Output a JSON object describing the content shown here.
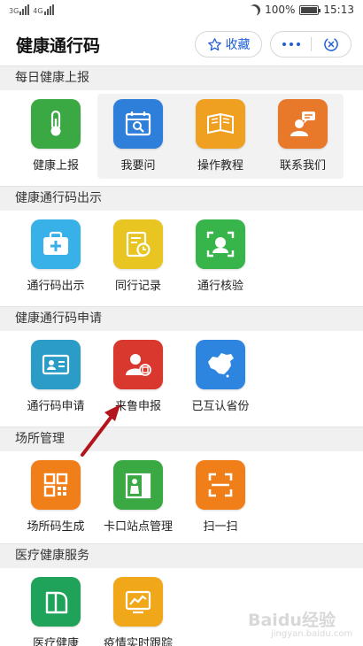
{
  "status_bar": {
    "signal_1": "3G",
    "signal_2": "4G",
    "battery_text": "100%",
    "battery_level": 1.0,
    "time": "15:13"
  },
  "header": {
    "title": "健康通行码",
    "favorite_label": "收藏",
    "accent_color": "#1f5fd6"
  },
  "sections": [
    {
      "title": "每日健康上报",
      "items": [
        {
          "label": "健康上报",
          "icon": "thermometer-icon",
          "color": "#3aa843"
        },
        {
          "label": "我要问",
          "icon": "calendar-search-icon",
          "color": "#2e7fd9"
        },
        {
          "label": "操作教程",
          "icon": "book-icon",
          "color": "#f0a020"
        },
        {
          "label": "联系我们",
          "icon": "contact-person-icon",
          "color": "#e8782a"
        }
      ]
    },
    {
      "title": "健康通行码出示",
      "items": [
        {
          "label": "通行码出示",
          "icon": "medical-kit-icon",
          "color": "#37b1e8"
        },
        {
          "label": "同行记录",
          "icon": "record-clock-icon",
          "color": "#e8c520"
        },
        {
          "label": "通行核验",
          "icon": "face-scan-icon",
          "color": "#38b54a"
        }
      ]
    },
    {
      "title": "健康通行码申请",
      "items": [
        {
          "label": "通行码申请",
          "icon": "id-card-icon",
          "color": "#2b9bc7"
        },
        {
          "label": "来鲁申报",
          "icon": "person-register-icon",
          "color": "#d8382e"
        },
        {
          "label": "已互认省份",
          "icon": "china-map-icon",
          "color": "#2e85e0"
        }
      ]
    },
    {
      "title": "场所管理",
      "items": [
        {
          "label": "场所码生成",
          "icon": "qr-code-icon",
          "color": "#f07f1a"
        },
        {
          "label": "卡口站点管理",
          "icon": "checkpoint-icon",
          "color": "#3aa843"
        },
        {
          "label": "扫一扫",
          "icon": "scan-icon",
          "color": "#f07f1a"
        }
      ]
    },
    {
      "title": "医疗健康服务",
      "items": [
        {
          "label": "医疗健康",
          "icon": "medical-health-icon",
          "color": "#1fa35a"
        },
        {
          "label": "疫情实时跟踪",
          "icon": "trend-chart-icon",
          "color": "#f0a81a"
        }
      ]
    }
  ],
  "watermark": {
    "brand": "Baidu经验",
    "url": "jingyan.baidu.com"
  }
}
